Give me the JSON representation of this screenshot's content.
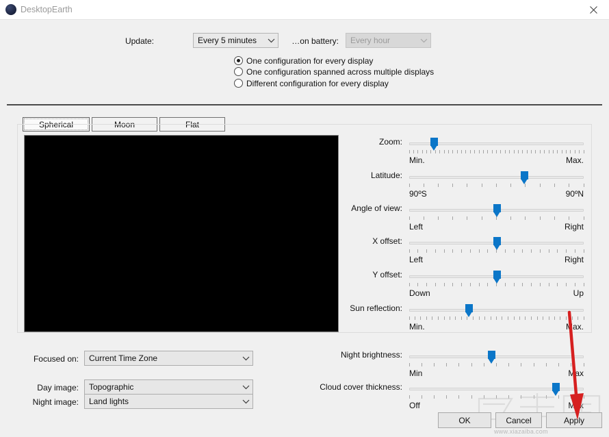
{
  "window": {
    "title": "DesktopEarth",
    "icon": "globe-icon",
    "close_label": "×"
  },
  "top": {
    "update_label": "Update:",
    "update_value": "Every 5 minutes",
    "battery_label": "…on battery:",
    "battery_value": "Every hour",
    "battery_disabled": true,
    "display_options": [
      {
        "label": "One configuration for every display",
        "selected": true
      },
      {
        "label": "One configuration spanned across multiple displays",
        "selected": false
      },
      {
        "label": "Different configuration for every display",
        "selected": false
      }
    ]
  },
  "tabs": [
    {
      "label": "Spherical",
      "selected": true
    },
    {
      "label": "Moon",
      "selected": false
    },
    {
      "label": "Flat",
      "selected": false
    }
  ],
  "sliders": [
    {
      "name": "zoom",
      "label": "Zoom:",
      "min_label": "Min.",
      "max_label": "Max.",
      "value_pct": 14,
      "ticks": 41
    },
    {
      "name": "latitude",
      "label": "Latitude:",
      "min_label": "90ºS",
      "max_label": "90ºN",
      "value_pct": 66,
      "ticks": 13
    },
    {
      "name": "angle-of-view",
      "label": "Angle of view:",
      "min_label": "Left",
      "max_label": "Right",
      "value_pct": 50,
      "ticks": 13
    },
    {
      "name": "x-offset",
      "label": "X offset:",
      "min_label": "Left",
      "max_label": "Right",
      "value_pct": 50,
      "ticks": 21
    },
    {
      "name": "y-offset",
      "label": "Y offset:",
      "min_label": "Down",
      "max_label": "Up",
      "value_pct": 50,
      "ticks": 21
    },
    {
      "name": "sun-reflection",
      "label": "Sun reflection:",
      "min_label": "Min.",
      "max_label": "Max.",
      "value_pct": 34,
      "ticks": 31
    }
  ],
  "bottom_sliders": [
    {
      "name": "night-brightness",
      "label": "Night brightness:",
      "min_label": "Min",
      "max_label": "Max",
      "value_pct": 47,
      "ticks": 15
    },
    {
      "name": "cloud-cover-thickness",
      "label": "Cloud cover thickness:",
      "min_label": "Off",
      "max_label": "Max",
      "value_pct": 84,
      "ticks": 15
    }
  ],
  "dropdowns": [
    {
      "name": "focused-on",
      "label": "Focused on:",
      "value": "Current Time Zone"
    },
    {
      "name": "day-image",
      "label": "Day image:",
      "value": "Topographic"
    },
    {
      "name": "night-image",
      "label": "Night image:",
      "value": "Land lights"
    }
  ],
  "buttons": {
    "ok": "OK",
    "cancel": "Cancel",
    "apply": "Apply"
  },
  "annotation": {
    "arrow_color": "#d62020",
    "points_to": "Apply"
  },
  "watermark": {
    "url": "www.xiazaiba.com"
  },
  "colors": {
    "accent": "#0b76c8",
    "window_bg": "#f0f0f0",
    "titlebar_bg": "#ffffff",
    "preview_bg": "#000000"
  }
}
